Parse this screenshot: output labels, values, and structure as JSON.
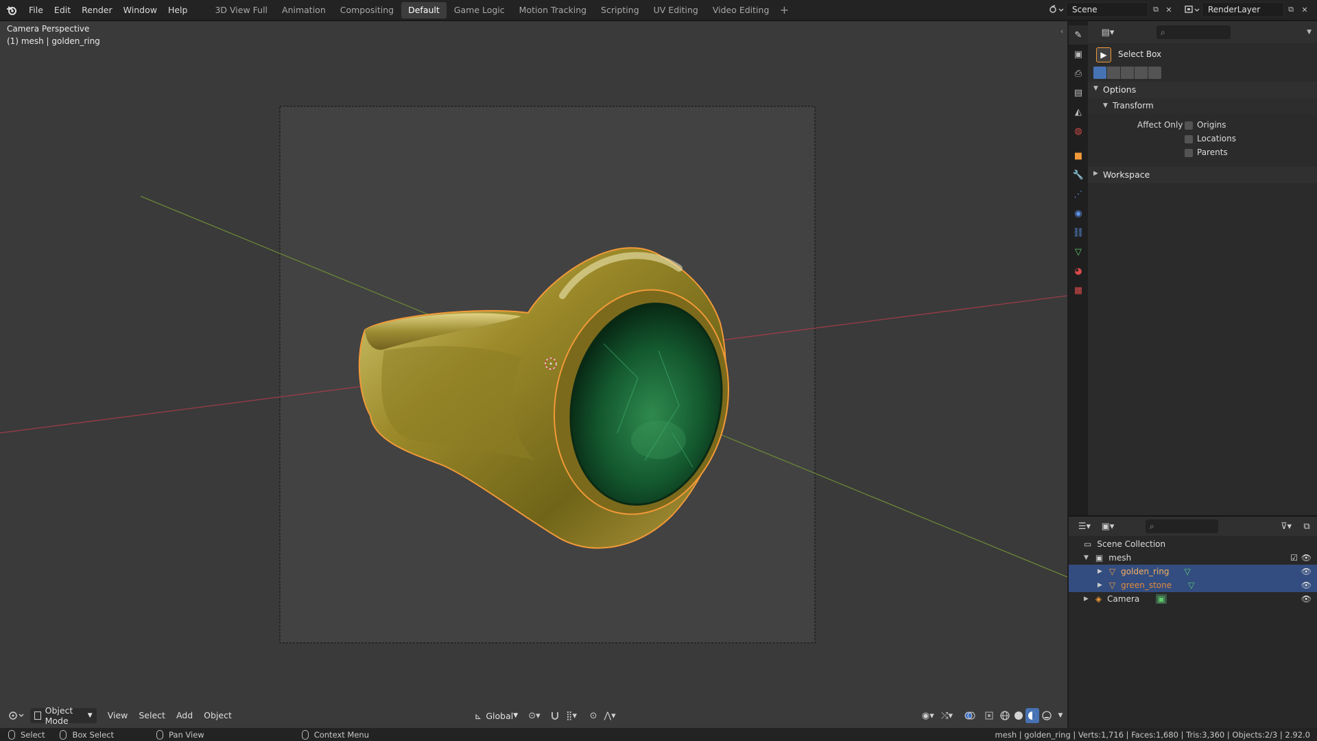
{
  "menu": {
    "items": [
      "File",
      "Edit",
      "Render",
      "Window",
      "Help"
    ]
  },
  "workspaces": {
    "tabs": [
      "3D View Full",
      "Animation",
      "Compositing",
      "Default",
      "Game Logic",
      "Motion Tracking",
      "Scripting",
      "UV Editing",
      "Video Editing"
    ],
    "active": "Default",
    "add_label": "+"
  },
  "scene": {
    "name": "Scene"
  },
  "render_layer": {
    "name": "RenderLayer"
  },
  "viewport": {
    "perspective": "Camera Perspective",
    "object_info": "(1) mesh | golden_ring",
    "mode": "Object Mode",
    "menus": [
      "View",
      "Select",
      "Add",
      "Object"
    ],
    "orientation": "Global"
  },
  "tool_settings": {
    "tool_name": "Select Box",
    "options_title": "Options",
    "transform_title": "Transform",
    "affect_only_label": "Affect Only",
    "affect_only": [
      {
        "label": "Origins",
        "checked": false
      },
      {
        "label": "Locations",
        "checked": false
      },
      {
        "label": "Parents",
        "checked": false
      }
    ],
    "workspace_title": "Workspace"
  },
  "outliner": {
    "root": "Scene Collection",
    "items": [
      {
        "label": "mesh",
        "type": "collection",
        "selected": false
      },
      {
        "label": "golden_ring",
        "type": "mesh",
        "selected": true
      },
      {
        "label": "green_stone",
        "type": "mesh",
        "selected": true
      },
      {
        "label": "Camera",
        "type": "camera",
        "selected": false
      }
    ]
  },
  "statusbar": {
    "select": "Select",
    "box_select": "Box Select",
    "pan_view": "Pan View",
    "context_menu": "Context Menu",
    "stats": "mesh | golden_ring | Verts:1,716 | Faces:1,680 | Tris:3,360 | Objects:2/3 | 2.92.0"
  },
  "colors": {
    "accent_selected": "#334d80",
    "active_object": "#f29a38",
    "x_axis": "#a0404a",
    "y_axis": "#6e8a3a"
  }
}
